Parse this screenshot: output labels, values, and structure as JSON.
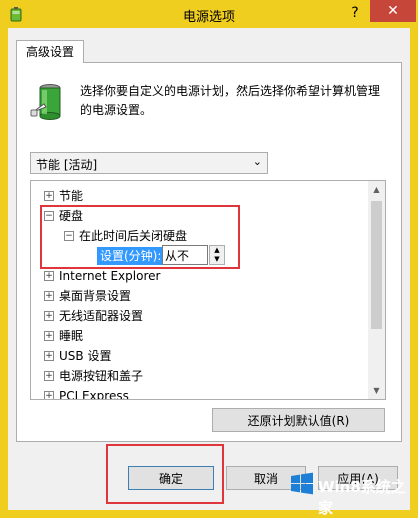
{
  "window": {
    "title": "电源选项",
    "help_label": "?",
    "close_label": "✕"
  },
  "tab": {
    "label": "高级设置"
  },
  "description": "选择你要自定义的电源计划，然后选择你希望计算机管理的电源设置。",
  "plan_select": {
    "value": "节能 [活动]"
  },
  "tree": {
    "items": [
      {
        "label": "节能",
        "expander": "+"
      },
      {
        "label": "硬盘",
        "expander": "−"
      },
      {
        "label": "在此时间后关闭硬盘",
        "expander": "−"
      },
      {
        "label": "Internet Explorer",
        "expander": "+"
      },
      {
        "label": "桌面背景设置",
        "expander": "+"
      },
      {
        "label": "无线适配器设置",
        "expander": "+"
      },
      {
        "label": "睡眠",
        "expander": "+"
      },
      {
        "label": "USB 设置",
        "expander": "+"
      },
      {
        "label": "电源按钮和盖子",
        "expander": "+"
      },
      {
        "label": "PCI Express",
        "expander": "+"
      }
    ],
    "setting_label": "设置(分钟):",
    "setting_value": "从不"
  },
  "buttons": {
    "restore": "还原计划默认值(R)",
    "ok": "确定",
    "cancel": "取消",
    "apply": "应用(A)"
  },
  "watermark": {
    "text": "Win8系统之家"
  },
  "colors": {
    "title_bar": "#f0ce20",
    "close_button": "#c7463a",
    "selection": "#3399ff",
    "highlight_box": "#e0353b"
  }
}
